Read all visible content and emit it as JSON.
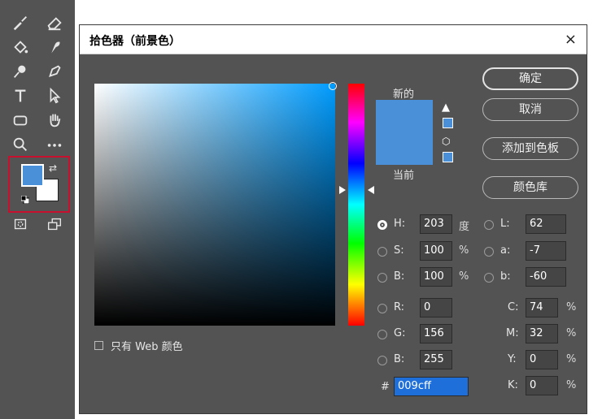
{
  "dialog": {
    "title": "拾色器（前景色）",
    "close": "×",
    "new_label": "新的",
    "current_label": "当前",
    "new_color": "#4a90d9",
    "current_color": "#4a90d9",
    "buttons": {
      "ok": "确定",
      "cancel": "取消",
      "add_swatch": "添加到色板",
      "libraries": "颜色库"
    },
    "web_only_label": "只有 Web 颜色",
    "hsb": {
      "h": {
        "label": "H:",
        "value": "203",
        "unit": "度"
      },
      "s": {
        "label": "S:",
        "value": "100",
        "unit": "%"
      },
      "b": {
        "label": "B:",
        "value": "100",
        "unit": "%"
      }
    },
    "rgb": {
      "r": {
        "label": "R:",
        "value": "0"
      },
      "g": {
        "label": "G:",
        "value": "156"
      },
      "b": {
        "label": "B:",
        "value": "255"
      }
    },
    "lab": {
      "l": {
        "label": "L:",
        "value": "62"
      },
      "a": {
        "label": "a:",
        "value": "-7"
      },
      "b": {
        "label": "b:",
        "value": "-60"
      }
    },
    "cmyk": {
      "c": {
        "label": "C:",
        "value": "74",
        "unit": "%"
      },
      "m": {
        "label": "M:",
        "value": "32",
        "unit": "%"
      },
      "y": {
        "label": "Y:",
        "value": "0",
        "unit": "%"
      },
      "k": {
        "label": "K:",
        "value": "0",
        "unit": "%"
      }
    },
    "hex": {
      "label": "#",
      "value": "009cff"
    }
  },
  "toolbar": {
    "foreground_color": "#4a90d9",
    "background_color": "#ffffff",
    "highlight_color": "#c8102e"
  }
}
